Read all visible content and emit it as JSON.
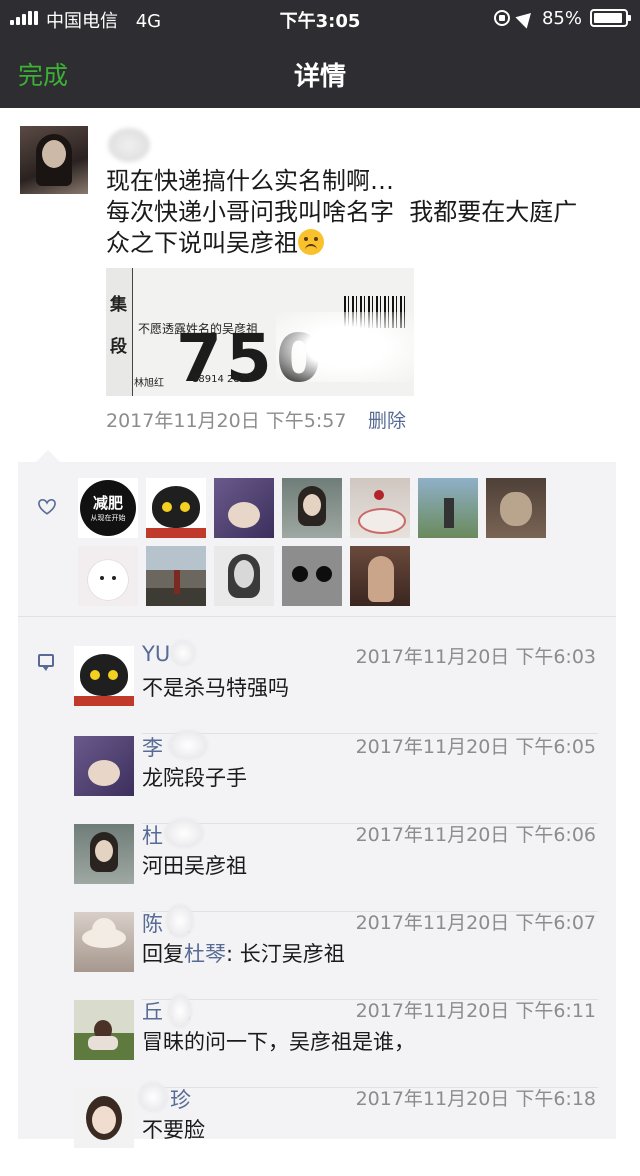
{
  "status": {
    "carrier": "中国电信",
    "network": "4G",
    "time": "下午3:05",
    "battery": "85%"
  },
  "nav": {
    "done_label": "完成",
    "title": "详情"
  },
  "post": {
    "lines": [
      "现在快递搞什么实名制啊…",
      "每次快递小哥问我叫啥名字  我都要在大庭广",
      "众之下说叫吴彦祖"
    ],
    "image": {
      "tag1": "集",
      "tag2": "段",
      "label": "不愿透露姓名的吴彦祖",
      "number": "750",
      "receiver": "林旭红",
      "phone": "18914 2827"
    },
    "time": "2017年11月20日 下午5:57",
    "delete_label": "删除"
  },
  "likes": {
    "avatars": [
      {
        "icon": "text-logo-avatar",
        "text": "减肥",
        "sub": "从现在开始"
      },
      {
        "icon": "cat-avatar"
      },
      {
        "icon": "hand-photo-avatar"
      },
      {
        "icon": "girl-portrait-avatar"
      },
      {
        "icon": "cake-photo-avatar"
      },
      {
        "icon": "outdoor-photo-avatar"
      },
      {
        "icon": "kitten-avatar"
      },
      {
        "icon": "white-dog-avatar"
      },
      {
        "icon": "landscape-avatar"
      },
      {
        "icon": "celebrity-portrait-avatar"
      },
      {
        "icon": "sunglasses-cat-avatar"
      },
      {
        "icon": "girl-hair-avatar"
      }
    ]
  },
  "comments": [
    {
      "name": "YU",
      "time": "2017年11月20日 下午6:03",
      "text": "不是杀马特强吗"
    },
    {
      "name": "李",
      "time": "2017年11月20日 下午6:05",
      "text": "龙院段子手"
    },
    {
      "name": "杜",
      "time": "2017年11月20日 下午6:06",
      "text": "河田吴彦祖"
    },
    {
      "name": "陈 燕",
      "time": "2017年11月20日 下午6:07",
      "reply_prefix": "回复",
      "reply_to": "杜琴",
      "text": ": 长汀吴彦祖"
    },
    {
      "name": "丘 城",
      "time": "2017年11月20日 下午6:11",
      "text": "冒昧的问一下，吴彦祖是谁，"
    },
    {
      "name": "珍",
      "time": "2017年11月20日 下午6:18",
      "text": "不要脸"
    }
  ]
}
